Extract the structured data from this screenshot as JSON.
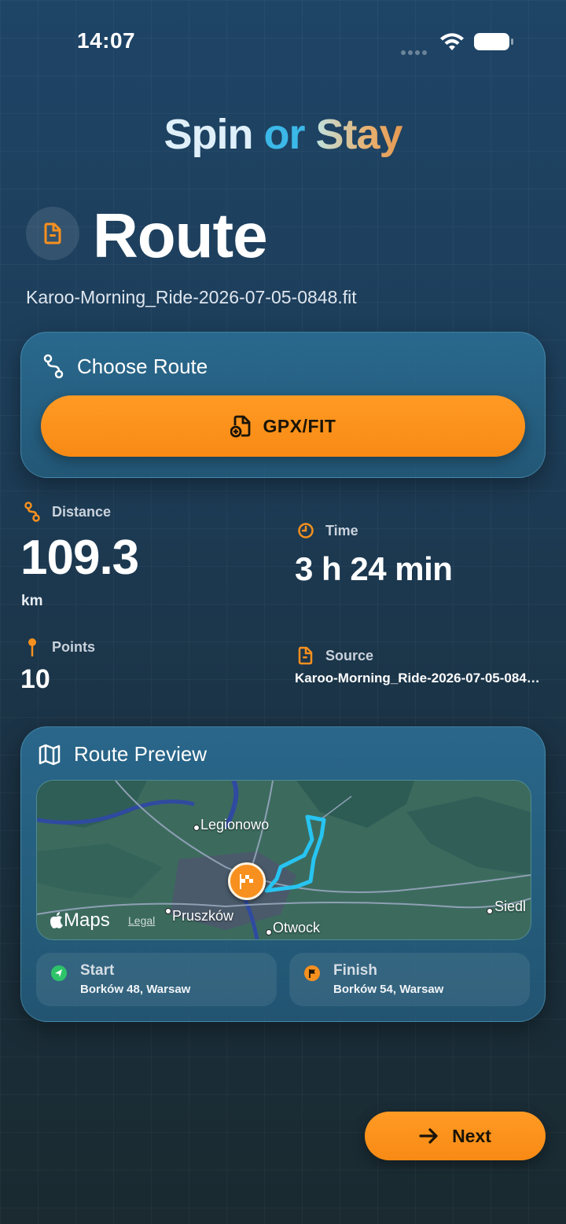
{
  "status_bar": {
    "time": "14:07"
  },
  "app_title": {
    "part1": "Spin",
    "part2": "or",
    "part3": "Stay"
  },
  "header": {
    "title": "Route",
    "filename": "Karoo-Morning_Ride-2026-07-05-0848.fit"
  },
  "choose_route": {
    "heading": "Choose Route",
    "button_label": "GPX/FIT"
  },
  "stats": {
    "distance_label": "Distance",
    "distance_value": "109.3",
    "distance_unit": "km",
    "time_label": "Time",
    "time_value": "3 h 24 min",
    "points_label": "Points",
    "points_value": "10",
    "source_label": "Source",
    "source_value": "Karoo-Morning_Ride-2026-07-05-0848.fit"
  },
  "route_preview": {
    "heading": "Route Preview",
    "map_places": [
      "Legionowo",
      "Pruszków",
      "Otwock",
      "Siedl"
    ],
    "maps_brand": "Maps",
    "legal": "Legal",
    "start": {
      "label": "Start",
      "address": "Borków 48, Warsaw"
    },
    "finish": {
      "label": "Finish",
      "address": "Borków 54, Warsaw"
    }
  },
  "footer": {
    "next_label": "Next"
  },
  "colors": {
    "accent_orange": "#f88a14",
    "route_line": "#27c4f2",
    "start_green": "#2ec46a"
  }
}
